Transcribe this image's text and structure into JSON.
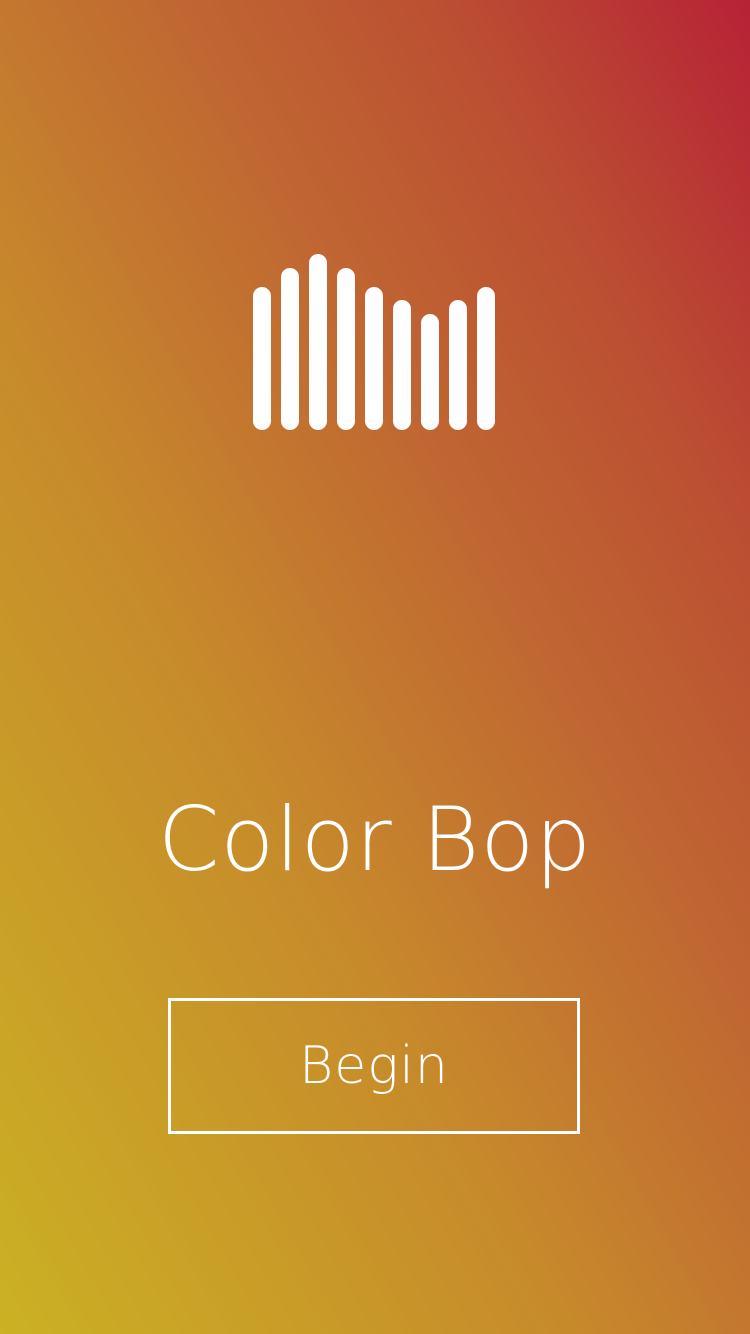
{
  "app": {
    "title": "Color Bop"
  },
  "logo": {
    "icon": "equalizer-bars-icon",
    "color": "#ffffff",
    "bar_levels": [
      0.81,
      0.92,
      1.0,
      0.92,
      0.81,
      0.74,
      0.66,
      0.74,
      0.81
    ]
  },
  "actions": {
    "begin_label": "Begin"
  },
  "colors": {
    "gradient_bottom_left": "#cbb124",
    "gradient_top_right": "#b72236",
    "foreground": "#ffffff"
  }
}
